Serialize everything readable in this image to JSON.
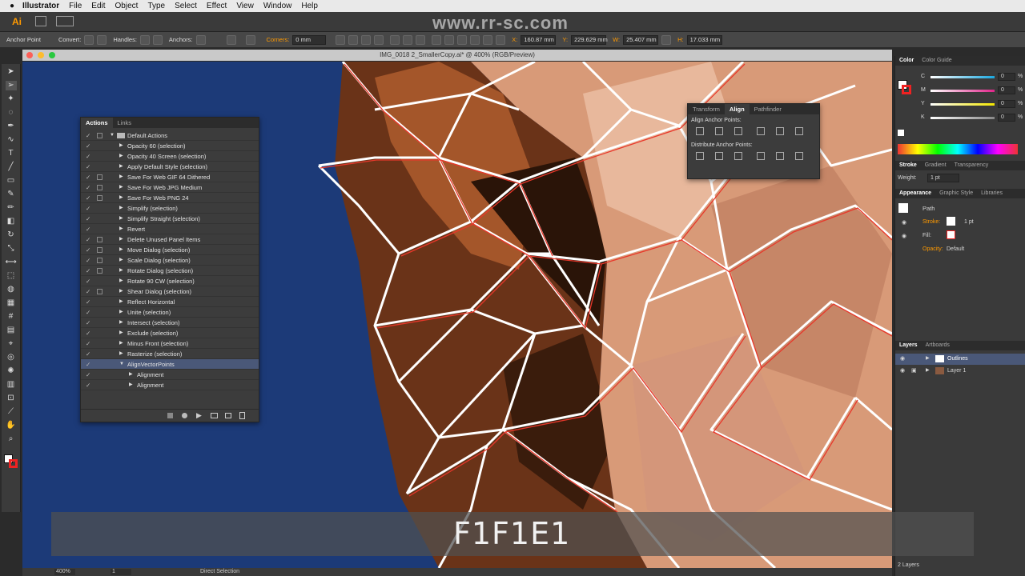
{
  "menubar": {
    "apple": "",
    "app_name": "Illustrator",
    "items": [
      "File",
      "Edit",
      "Object",
      "Type",
      "Select",
      "Effect",
      "View",
      "Window",
      "Help"
    ]
  },
  "appbar": {
    "logo": "Ai",
    "watermark": "www.rr-sc.com"
  },
  "control": {
    "tool_label": "Anchor Point",
    "convert_label": "Convert:",
    "handles_label": "Handles:",
    "anchors_label": "Anchors:",
    "corners_label": "Corners:",
    "corners_value": "0 mm",
    "x_label": "X:",
    "x_value": "160.87 mm",
    "y_label": "Y:",
    "y_value": "229.629 mm",
    "w_label": "W:",
    "w_value": "25.407 mm",
    "h_label": "H:",
    "h_value": "17.033 mm"
  },
  "document": {
    "title": "IMG_0018 2_SmallerCopy.ai* @ 400% (RGB/Preview)"
  },
  "actions_panel": {
    "tabs": [
      "Actions",
      "Links"
    ],
    "rows": [
      {
        "label": "Default Actions",
        "level": 0,
        "folder": true,
        "dialog": true
      },
      {
        "label": "Opacity 60 (selection)",
        "level": 1,
        "dialog": false
      },
      {
        "label": "Opacity 40 Screen (selection)",
        "level": 1,
        "dialog": false
      },
      {
        "label": "Apply Default Style (selection)",
        "level": 1,
        "dialog": false
      },
      {
        "label": "Save For Web GIF 64 Dithered",
        "level": 1,
        "dialog": true
      },
      {
        "label": "Save For Web JPG Medium",
        "level": 1,
        "dialog": true
      },
      {
        "label": "Save For Web PNG 24",
        "level": 1,
        "dialog": true
      },
      {
        "label": "Simplify (selection)",
        "level": 1,
        "dialog": false
      },
      {
        "label": "Simplify Straight (selection)",
        "level": 1,
        "dialog": false
      },
      {
        "label": "Revert",
        "level": 1,
        "dialog": false
      },
      {
        "label": "Delete Unused Panel Items",
        "level": 1,
        "dialog": true
      },
      {
        "label": "Move Dialog (selection)",
        "level": 1,
        "dialog": true
      },
      {
        "label": "Scale Dialog (selection)",
        "level": 1,
        "dialog": true
      },
      {
        "label": "Rotate Dialog (selection)",
        "level": 1,
        "dialog": true
      },
      {
        "label": "Rotate 90 CW (selection)",
        "level": 1,
        "dialog": false
      },
      {
        "label": "Shear Dialog (selection)",
        "level": 1,
        "dialog": true
      },
      {
        "label": "Reflect Horizontal",
        "level": 1,
        "dialog": false
      },
      {
        "label": "Unite (selection)",
        "level": 1,
        "dialog": false
      },
      {
        "label": "Intersect (selection)",
        "level": 1,
        "dialog": false
      },
      {
        "label": "Exclude (selection)",
        "level": 1,
        "dialog": false
      },
      {
        "label": "Minus Front (selection)",
        "level": 1,
        "dialog": false
      },
      {
        "label": "Rasterize (selection)",
        "level": 1,
        "dialog": false
      },
      {
        "label": "AlignVectorPoints",
        "level": 1,
        "dialog": false,
        "selected": true,
        "open": true
      },
      {
        "label": "Alignment",
        "level": 2,
        "dialog": false
      },
      {
        "label": "Alignment",
        "level": 2,
        "dialog": false
      }
    ]
  },
  "align_panel": {
    "tabs": [
      "Transform",
      "Align",
      "Pathfinder"
    ],
    "align_anchor_label": "Align Anchor Points:",
    "distribute_anchor_label": "Distribute Anchor Points:"
  },
  "color_panel": {
    "tabs": [
      "Color",
      "Color Guide"
    ],
    "channels": [
      {
        "name": "C",
        "value": "0",
        "color": "#1aa8e0"
      },
      {
        "name": "M",
        "value": "0",
        "color": "#e0258a"
      },
      {
        "name": "Y",
        "value": "0",
        "color": "#f2e600"
      },
      {
        "name": "K",
        "value": "0",
        "color": "#888888"
      }
    ],
    "pct": "%"
  },
  "stroke_panel": {
    "tabs": [
      "Stroke",
      "Gradient",
      "Transparency"
    ],
    "weight_label": "Weight:",
    "weight_value": "1 pt"
  },
  "appearance_panel": {
    "tabs": [
      "Appearance",
      "Graphic Style",
      "Libraries"
    ],
    "object": "Path",
    "stroke_label": "Stroke:",
    "stroke_value": "1 pt",
    "fill_label": "Fill:",
    "opacity_label": "Opacity:",
    "opacity_value": "Default"
  },
  "layers_panel": {
    "tabs": [
      "Layers",
      "Artboards"
    ],
    "layers": [
      {
        "name": "Outlines",
        "selected": true
      },
      {
        "name": "Layer 1",
        "selected": false
      }
    ],
    "footer": "2 Layers"
  },
  "status": {
    "zoom": "400%",
    "page": "1",
    "tool": "Direct Selection"
  },
  "subtitle": "F1F1E1",
  "colors": {
    "accent_orange": "#ff9a00",
    "selection_blue": "#4a5878",
    "canvas_blue": "#1c3a78"
  }
}
